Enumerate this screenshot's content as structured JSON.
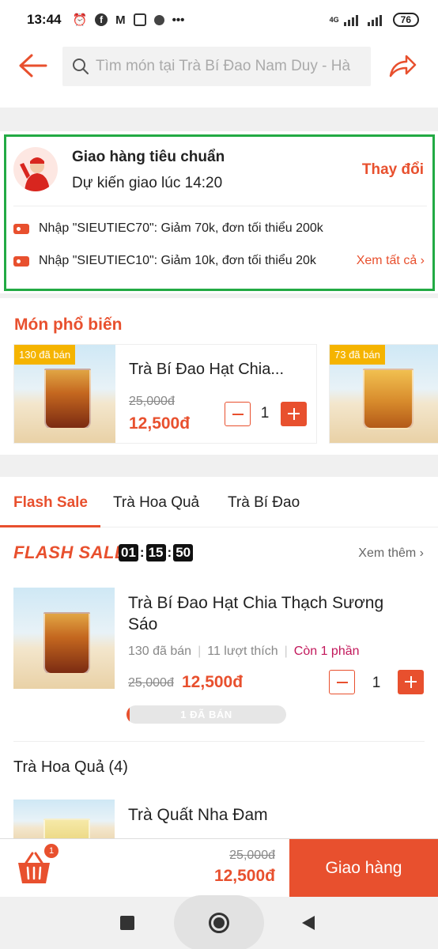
{
  "status_bar": {
    "time": "13:44",
    "network": "4G",
    "battery": "76"
  },
  "header": {
    "search_placeholder": "Tìm món tại Trà Bí Đao Nam Duy - Hà"
  },
  "delivery": {
    "title": "Giao hàng tiêu chuẩn",
    "eta": "Dự kiến giao lúc 14:20",
    "change_label": "Thay đổi",
    "promos": [
      "Nhập \"SIEUTIEC70\": Giảm 70k, đơn tối thiểu 200k",
      "Nhập \"SIEUTIEC10\": Giảm 10k, đơn tối thiểu 20k"
    ],
    "see_all": "Xem tất cả"
  },
  "popular": {
    "title": "Món phổ biến",
    "items": [
      {
        "badge": "130 đã bán",
        "name": "Trà Bí Đao Hạt Chia...",
        "old_price": "25,000đ",
        "new_price": "12,500đ",
        "qty": "1"
      },
      {
        "badge": "73 đã bán"
      }
    ]
  },
  "tabs": [
    "Flash Sale",
    "Trà Hoa Quả",
    "Trà Bí Đao"
  ],
  "flash_sale": {
    "logo": "FLASH SALE",
    "timer": [
      "01",
      "15",
      "50"
    ],
    "see_more": "Xem thêm",
    "item": {
      "name": "Trà Bí Đao Hạt Chia Thạch Sương Sáo",
      "sold": "130 đã bán",
      "likes": "11 lượt thích",
      "remaining": "Còn 1 phần",
      "old_price": "25,000đ",
      "new_price": "12,500đ",
      "qty": "1",
      "progress_label": "1 ĐÃ BÁN",
      "progress_fraction": 0.02
    }
  },
  "category": {
    "title": "Trà Hoa Quả (4)",
    "item_name": "Trà Quất Nha Đam"
  },
  "cart": {
    "count": "1",
    "old_total": "25,000đ",
    "new_total": "12,500đ",
    "checkout_label": "Giao hàng"
  },
  "colors": {
    "accent": "#e8502e",
    "highlight_frame": "#22aa44",
    "badge": "#f5b400"
  }
}
